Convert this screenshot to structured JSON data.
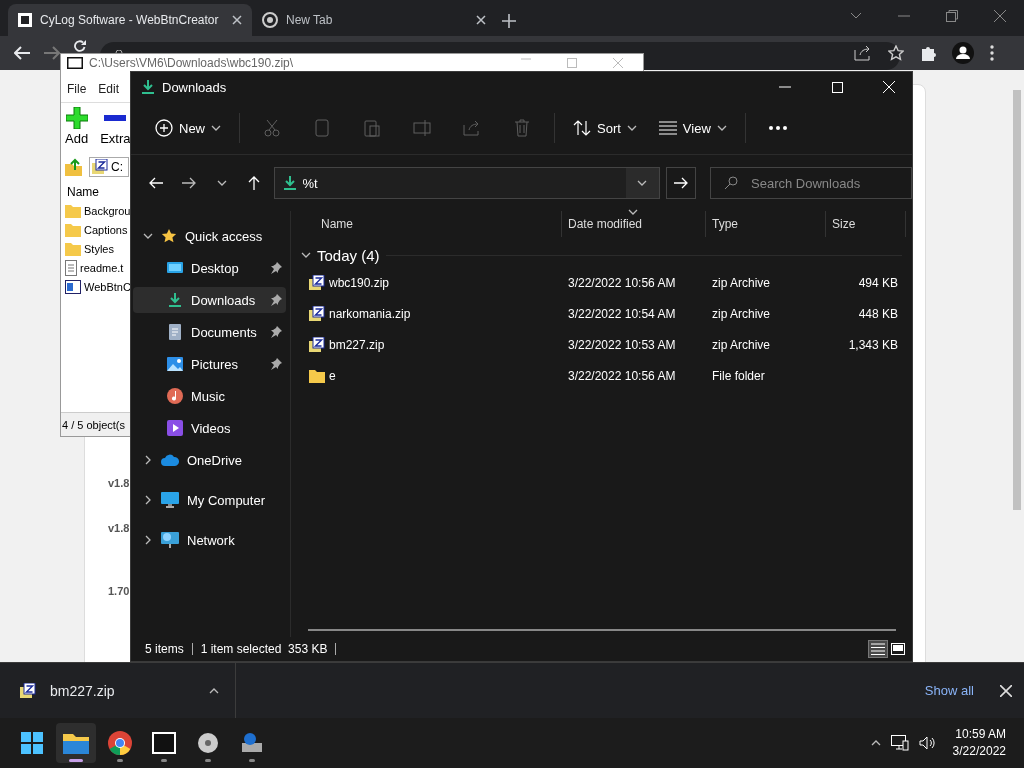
{
  "browser": {
    "tabs": [
      {
        "title": "CyLog Software - WebBtnCreator",
        "kind": "site",
        "selected": true
      },
      {
        "title": "New Tab",
        "kind": "chrome",
        "selected": false
      }
    ],
    "page_texts": [
      "v1.8",
      "v1.8",
      "1.70"
    ]
  },
  "archive_window": {
    "title": "C:\\Users\\VM6\\Downloads\\wbc190.zip\\",
    "menu": [
      "File",
      "Edit"
    ],
    "tools": [
      {
        "label": "Add",
        "kind": "add"
      },
      {
        "label": "Extra",
        "kind": "extract"
      }
    ],
    "path": "C:",
    "column": "Name",
    "items": [
      {
        "name": "Backgrou",
        "kind": "folder"
      },
      {
        "name": "Captions",
        "kind": "folder"
      },
      {
        "name": "Styles",
        "kind": "folder"
      },
      {
        "name": "readme.t",
        "kind": "text"
      },
      {
        "name": "WebBtnC",
        "kind": "app"
      }
    ],
    "status": "4 / 5 object(s"
  },
  "explorer": {
    "title": "Downloads",
    "toolbar": [
      {
        "kind": "new",
        "label": "New",
        "disabled": false
      },
      {
        "kind": "cut",
        "disabled": true
      },
      {
        "kind": "copy",
        "disabled": true
      },
      {
        "kind": "paste",
        "disabled": true
      },
      {
        "kind": "rename",
        "disabled": true
      },
      {
        "kind": "share",
        "disabled": true
      },
      {
        "kind": "delete",
        "disabled": true
      },
      {
        "kind": "sort",
        "label": "Sort",
        "disabled": false
      },
      {
        "kind": "view",
        "label": "View",
        "disabled": false
      },
      {
        "kind": "more",
        "disabled": false
      }
    ],
    "address_value": "%t",
    "search": {
      "placeholder": "Search Downloads"
    },
    "sidebar": [
      {
        "label": "Quick access",
        "kind": "star",
        "expanded": true,
        "selected": false,
        "children": [
          {
            "label": "Desktop",
            "kind": "desktop",
            "pinned": true,
            "selected": false
          },
          {
            "label": "Downloads",
            "kind": "downloads",
            "pinned": true,
            "selected": true
          },
          {
            "label": "Documents",
            "kind": "documents",
            "pinned": true,
            "selected": false
          },
          {
            "label": "Pictures",
            "kind": "pictures",
            "pinned": true,
            "selected": false
          },
          {
            "label": "Music",
            "kind": "music",
            "pinned": false,
            "selected": false
          },
          {
            "label": "Videos",
            "kind": "videos",
            "pinned": false,
            "selected": false
          }
        ]
      },
      {
        "label": "OneDrive",
        "kind": "cloud",
        "expanded": false,
        "selected": false
      },
      {
        "label": "My Computer",
        "kind": "computer",
        "expanded": false,
        "selected": false
      },
      {
        "label": "Network",
        "kind": "network",
        "expanded": false,
        "selected": false
      }
    ],
    "columns": [
      {
        "label": "Name",
        "sorted": false
      },
      {
        "label": "Date modified",
        "sorted": true
      },
      {
        "label": "Type",
        "sorted": false
      },
      {
        "label": "Size",
        "sorted": false
      }
    ],
    "groups": [
      {
        "label": "Today (4)",
        "expanded": true,
        "rows": [
          {
            "name": "wbc190.zip",
            "date": "3/22/2022 10:56 AM",
            "type": "zip Archive",
            "size": "494 KB",
            "kind": "zip",
            "selected": false
          },
          {
            "name": "narkomania.zip",
            "date": "3/22/2022 10:54 AM",
            "type": "zip Archive",
            "size": "448 KB",
            "kind": "zip",
            "selected": false
          },
          {
            "name": "bm227.zip",
            "date": "3/22/2022 10:53 AM",
            "type": "zip Archive",
            "size": "1,343 KB",
            "kind": "zip",
            "selected": false
          },
          {
            "name": "e",
            "date": "3/22/2022 10:56 AM",
            "type": "File folder",
            "kind": "folder",
            "selected": false
          }
        ]
      }
    ],
    "status": {
      "items": "5 items",
      "selection": "1 item selected",
      "size": "353 KB"
    },
    "view_modes": [
      {
        "kind": "details",
        "selected": true
      },
      {
        "kind": "tiles",
        "selected": false
      }
    ]
  },
  "download_bar": {
    "file": "bm227.zip",
    "show_all": "Show all"
  },
  "taskbar": {
    "apps": [
      {
        "kind": "explorer",
        "active": true
      },
      {
        "kind": "chrome",
        "active": false
      },
      {
        "kind": "archiver",
        "active": false
      },
      {
        "kind": "disc",
        "active": false
      },
      {
        "kind": "installer",
        "active": false
      }
    ],
    "time": "10:59 AM",
    "date": "3/22/2022"
  }
}
